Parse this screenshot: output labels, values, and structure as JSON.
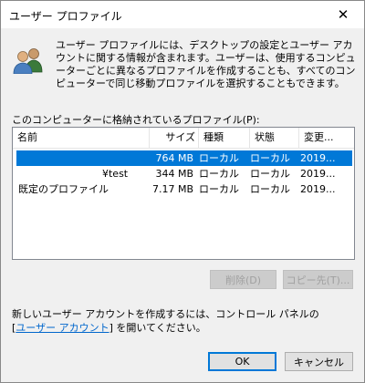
{
  "window": {
    "title": "ユーザー プロファイル",
    "close_glyph": "✕"
  },
  "description": "ユーザー プロファイルには、デスクトップの設定とユーザー アカウントに関する情報が含まれます。ユーザーは、使用するコンピューターごとに異なるプロファイルを作成することも、すべてのコンピューターで同じ移動プロファイルを選択することもできます。",
  "list_label": "このコンピューターに格納されているプロファイル(P):",
  "table": {
    "columns": [
      "名前",
      "サイズ",
      "種類",
      "状態",
      "変更..."
    ],
    "rows": [
      {
        "name": "",
        "size": "764 MB",
        "type": "ローカル",
        "status": "ローカル",
        "modified": "2019...",
        "selected": true
      },
      {
        "name": "¥test",
        "size": "344 MB",
        "type": "ローカル",
        "status": "ローカル",
        "modified": "2019...",
        "selected": false
      },
      {
        "name": "既定のプロファイル",
        "size": "7.17 MB",
        "type": "ローカル",
        "status": "ローカル",
        "modified": "2019...",
        "selected": false
      }
    ]
  },
  "buttons": {
    "delete": "削除(D)",
    "copy_to": "コピー先(T)...",
    "ok": "OK",
    "cancel": "キャンセル"
  },
  "footer": {
    "line1": "新しいユーザー アカウントを作成するには、コントロール パネルの",
    "link_open": "[",
    "link_text": "ユーザー アカウント",
    "link_close": "]",
    "line2_suffix": " を開いてください。"
  },
  "colors": {
    "selection": "#0078d7",
    "link": "#0066cc"
  },
  "icons": {
    "window_icon": "users-icon",
    "close": "close-icon"
  }
}
